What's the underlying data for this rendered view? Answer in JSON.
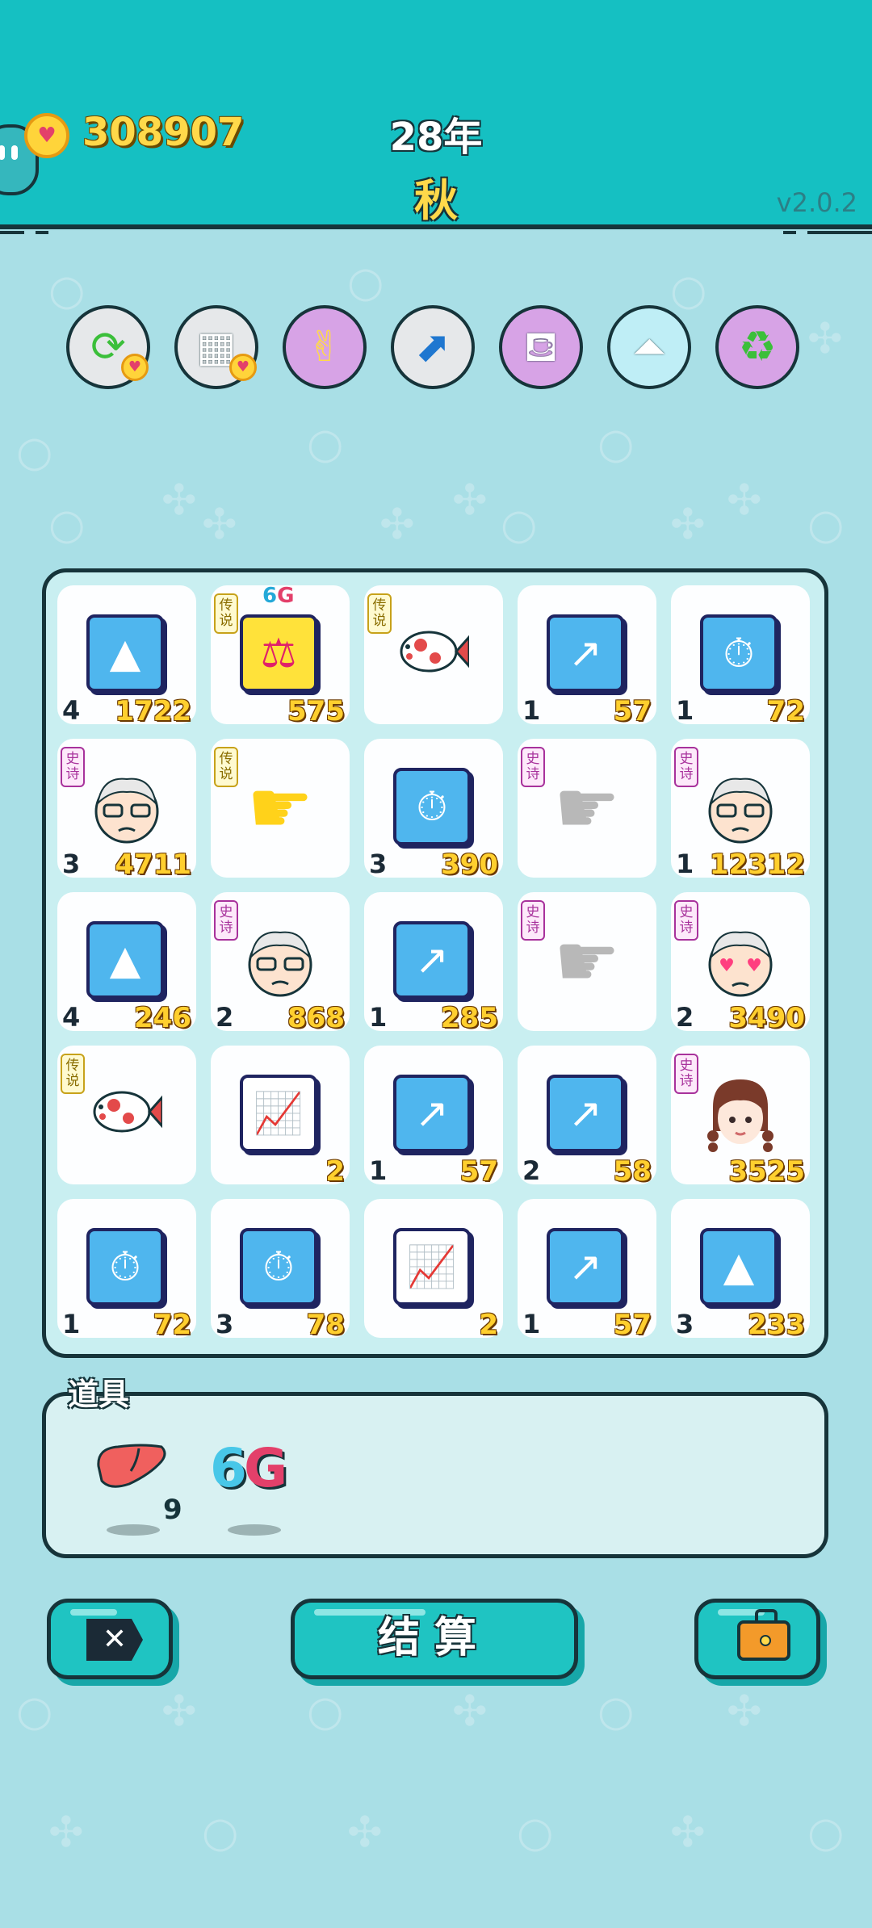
{
  "header": {
    "coins": "308907",
    "year": "28年",
    "season": "秋",
    "version": "v2.0.2",
    "coin_icon": "gold-coin-heart-icon",
    "avatar_icon": "blob-avatar-icon"
  },
  "skills": [
    {
      "name": "refresh-icon",
      "bg": "#e6e8ea"
    },
    {
      "name": "blocks-icon",
      "bg": "#e6e8ea"
    },
    {
      "name": "rock-hand-icon",
      "bg": "#d7a3e6"
    },
    {
      "name": "arrow-up-icon",
      "bg": "#e6e8ea"
    },
    {
      "name": "gravy-boat-icon",
      "bg": "#d7a3e6"
    },
    {
      "name": "skirt-icon",
      "bg": "#bfeef6"
    },
    {
      "name": "recycle-icon",
      "bg": "#d7a3e6"
    }
  ],
  "board": {
    "rows": [
      [
        {
          "icon": "gold-bars-icon",
          "count": "4",
          "value": "1722"
        },
        {
          "icon": "balance-scale-icon",
          "badge": "传说",
          "tag": "6G",
          "count": "",
          "value": "575"
        },
        {
          "icon": "koi-fish-icon",
          "badge": "传说",
          "count": "",
          "value": ""
        },
        {
          "icon": "trend-line-icon",
          "count": "1",
          "value": "57"
        },
        {
          "icon": "stopwatch-icon",
          "count": "1",
          "value": "72"
        }
      ],
      [
        {
          "icon": "old-man-icon",
          "badge": "史诗",
          "count": "3",
          "value": "4711"
        },
        {
          "icon": "pointing-hand-icon",
          "badge": "传说",
          "count": "",
          "value": ""
        },
        {
          "icon": "stopwatch-icon",
          "count": "3",
          "value": "390"
        },
        {
          "icon": "grey-hand-icon",
          "badge": "史诗",
          "count": "",
          "value": ""
        },
        {
          "icon": "old-man-icon",
          "badge": "史诗",
          "count": "1",
          "value": "12312"
        }
      ],
      [
        {
          "icon": "gold-bars-icon",
          "count": "4",
          "value": "246"
        },
        {
          "icon": "old-man-icon",
          "badge": "史诗",
          "count": "2",
          "value": "868"
        },
        {
          "icon": "trend-line-icon",
          "count": "1",
          "value": "285"
        },
        {
          "icon": "grey-hand-icon",
          "badge": "史诗",
          "count": "",
          "value": ""
        },
        {
          "icon": "heart-eyes-old-man-icon",
          "badge": "史诗",
          "count": "2",
          "value": "3490"
        }
      ],
      [
        {
          "icon": "koi-fish-icon",
          "badge": "传说",
          "count": "",
          "value": ""
        },
        {
          "icon": "growth-chart-icon",
          "count": "",
          "value": "2"
        },
        {
          "icon": "trend-line-icon",
          "count": "1",
          "value": "57"
        },
        {
          "icon": "trend-line-icon",
          "count": "2",
          "value": "58"
        },
        {
          "icon": "braided-girl-icon",
          "badge": "史诗",
          "count": "",
          "value": "3525"
        }
      ],
      [
        {
          "icon": "stopwatch-icon",
          "count": "1",
          "value": "72"
        },
        {
          "icon": "stopwatch-icon",
          "count": "3",
          "value": "78"
        },
        {
          "icon": "growth-chart-icon",
          "count": "",
          "value": "2"
        },
        {
          "icon": "trend-line-icon",
          "count": "1",
          "value": "57"
        },
        {
          "icon": "gold-bars-icon",
          "count": "3",
          "value": "233"
        }
      ]
    ]
  },
  "props": {
    "title": "道具",
    "items": [
      {
        "icon": "liver-icon",
        "count": "9"
      },
      {
        "icon": "6g-icon",
        "label_a": "6",
        "label_b": "G"
      }
    ]
  },
  "actions": {
    "close_icon": "close-x-icon",
    "settle_label": "结算",
    "bag_icon": "briefcase-icon"
  }
}
